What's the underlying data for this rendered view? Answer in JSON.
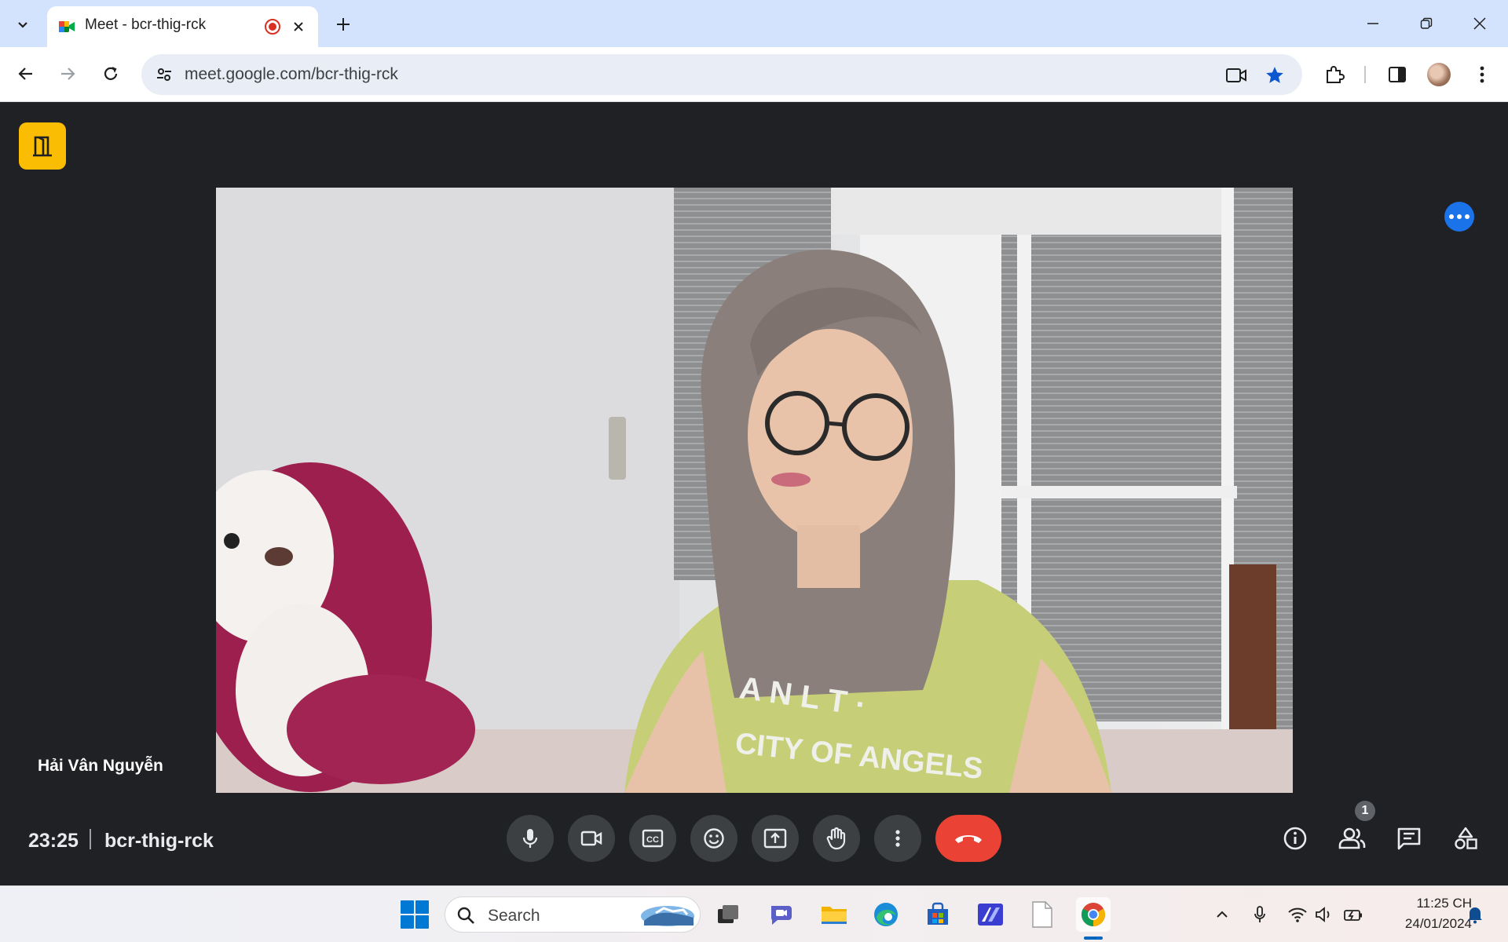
{
  "browser": {
    "tab_title": "Meet - bcr-thig-rck",
    "url": "meet.google.com/bcr-thig-rck"
  },
  "meet": {
    "participant_name": "Hải Vân Nguyễn",
    "meeting_time": "23:25",
    "meeting_code": "bcr-thig-rck",
    "people_count": "1",
    "controls": [
      "mic-icon",
      "camera-icon",
      "captions-icon",
      "emoji-icon",
      "present-icon",
      "raise-hand-icon",
      "more-options-icon",
      "leave-call-icon"
    ],
    "right_controls": [
      "info-icon",
      "people-icon",
      "chat-icon",
      "activities-icon"
    ],
    "leave_color": "#ea4335",
    "accent_color": "#1a73e8"
  },
  "taskbar": {
    "search_placeholder": "Search",
    "clock_time": "11:25 CH",
    "clock_date": "24/01/2024"
  }
}
